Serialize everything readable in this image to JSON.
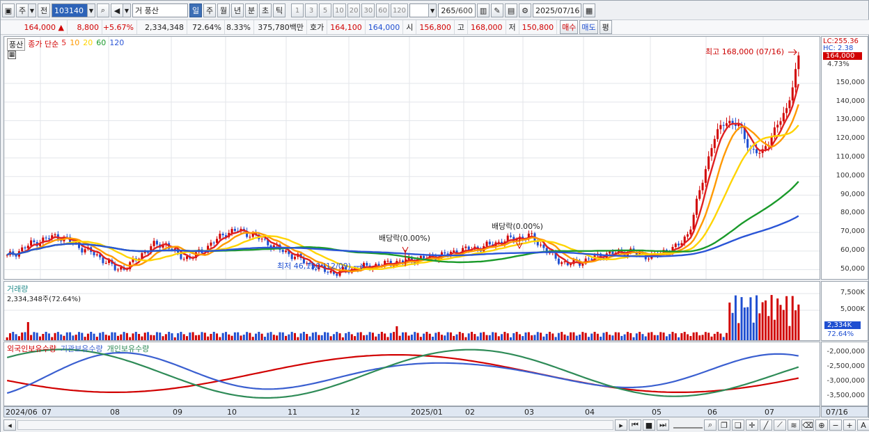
{
  "toolbar": {
    "market": "주",
    "prev": "전",
    "code": "103140",
    "name": "풍산",
    "name_prefix": "거",
    "periods": [
      "일",
      "주",
      "월",
      "년",
      "분",
      "초",
      "틱"
    ],
    "active_period": "일",
    "intervals": [
      "1",
      "3",
      "5",
      "10",
      "20",
      "30",
      "60",
      "120"
    ],
    "count": "265",
    "count_total": "/600",
    "date": "2025/07/16"
  },
  "quote": {
    "price": "164,000",
    "change_arrow": "▲",
    "change": "8,800",
    "change_pct": "+5.67%",
    "volume": "2,334,348",
    "vol_ratio": "72.64%",
    "turnover": "8.33%",
    "amount": "375,780백만",
    "hoga_label": "호가",
    "ask": "164,100",
    "bid": "164,000",
    "open_label": "시",
    "open": "156,800",
    "high_label": "고",
    "high": "168,000",
    "low_label": "저",
    "low": "150,800",
    "buy_label": "매수",
    "sell_label": "매도",
    "eval_label": "평"
  },
  "legend": {
    "name": "풍산",
    "series_label": "종가 단순",
    "ma": [
      "5",
      "10",
      "20",
      "60",
      "120"
    ],
    "ma_colors": [
      "#e02020",
      "#ff9900",
      "#ffd400",
      "#1a9a2a",
      "#2a55d6"
    ]
  },
  "annotations": {
    "high": "최고 168,000 (07/16)",
    "low": "최저 46,150 (12/09)",
    "div1": "배당락(0.00%)",
    "div2": "배당락(0.00%)"
  },
  "right_axis": {
    "lc": "LC:255.36",
    "hc": "HC: 2.38",
    "price_tag": "164,000",
    "pct_tag": "4.73%",
    "ticks": [
      "150,000",
      "140,000",
      "130,000",
      "120,000",
      "110,000",
      "100,000",
      "90,000",
      "80,000",
      "70,000",
      "60,000",
      "50,000"
    ]
  },
  "volume": {
    "title": "거래량",
    "value": "2,334,348주(72.64%)",
    "ticks": [
      "7,500K",
      "5,000K"
    ],
    "tag": "2,334K",
    "tag_pct": "72.64%"
  },
  "holdings": {
    "titles": [
      "외국인보유수량",
      "기관보유수량",
      "개인보유수량"
    ],
    "colors": [
      "#d10000",
      "#3a5fd0",
      "#2e8b57"
    ],
    "ticks": [
      "-2,000,000",
      "-2,500,000",
      "-3,000,000",
      "-3,500,000"
    ]
  },
  "dates": [
    "2024/06",
    "07",
    "08",
    "09",
    "10",
    "11",
    "12",
    "2025/01",
    "02",
    "03",
    "04",
    "05",
    "06",
    "07"
  ],
  "date_right": "07/16",
  "chart_data": {
    "type": "candlestick",
    "ylim": [
      45000,
      175000
    ],
    "ma_periods": [
      5,
      10,
      20,
      60,
      120
    ],
    "close_approx": [
      57000,
      60000,
      64000,
      66000,
      68000,
      66000,
      62000,
      59000,
      55000,
      50000,
      52000,
      58000,
      63000,
      64000,
      58000,
      56000,
      60000,
      65000,
      70000,
      71000,
      69000,
      66000,
      62000,
      59000,
      56000,
      52000,
      50000,
      48000,
      50000,
      51000,
      52000,
      53000,
      54000,
      55000,
      56000,
      57000,
      58000,
      60000,
      61000,
      62000,
      64000,
      66000,
      67000,
      68000,
      62000,
      56000,
      53000,
      54000,
      56000,
      58000,
      59000,
      60000,
      58000,
      57000,
      60000,
      62000,
      70000,
      95000,
      120000,
      130000,
      128000,
      115000,
      112000,
      125000,
      135000,
      164000
    ],
    "high": 168000,
    "high_date": "07/16",
    "low": 46150,
    "low_date": "12/09"
  }
}
